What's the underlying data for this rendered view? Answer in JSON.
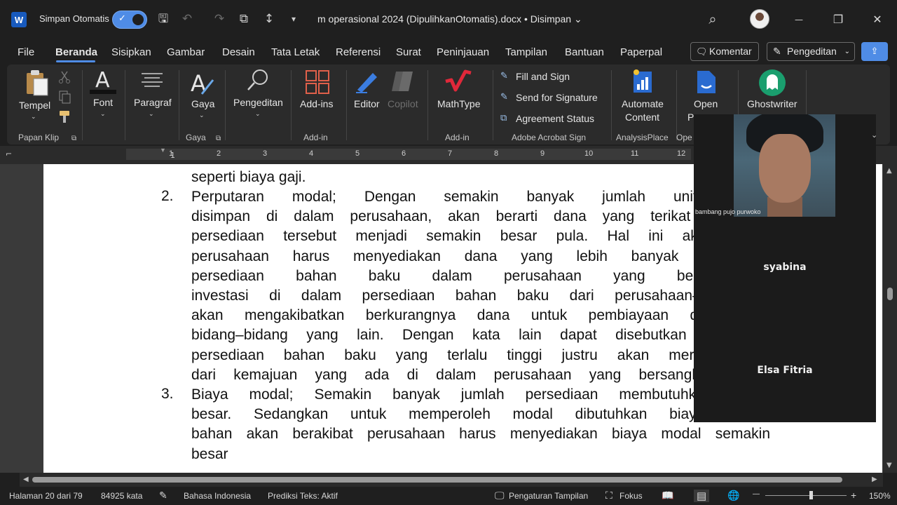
{
  "titlebar": {
    "app_logo": "W",
    "autosave_label": "Simpan Otomatis",
    "autosave_on": true,
    "doc_title": "m operasional 2024 (DipulihkanOtomatis).docx",
    "save_state": "Disimpan",
    "separator": "•",
    "chev": "⌄",
    "icons": {
      "save": "🖫",
      "undo": "↶",
      "redo": "↷",
      "copy": "⧉",
      "spacing": "↕",
      "customize": "▾",
      "search": "⌕",
      "minimize": "—",
      "restore": "❐",
      "close": "✕",
      "check": "✓"
    }
  },
  "menu": {
    "tabs": [
      "File",
      "Beranda",
      "Sisipkan",
      "Gambar",
      "Desain",
      "Tata Letak",
      "Referensi",
      "Surat",
      "Peninjauan",
      "Tampilan",
      "Bantuan",
      "Paperpal"
    ],
    "active": "Beranda",
    "komentar": "Komentar",
    "pengeditan": "Pengeditan",
    "icons": {
      "comment": "🗨",
      "pen": "✎",
      "chev": "⌄",
      "share": "⇪"
    }
  },
  "ribbon": {
    "tempel": "Tempel",
    "font": "Font",
    "paragraf": "Paragraf",
    "gaya": "Gaya",
    "pengeditan": "Pengeditan",
    "addins": "Add-ins",
    "editor": "Editor",
    "copilot": "Copilot",
    "mathtype": "MathType",
    "fill_sign": "Fill and Sign",
    "send_signature": "Send for Signature",
    "agreement_status": "Agreement Status",
    "automate": "Automate",
    "content": "Content",
    "open": "Open",
    "open_p": "P",
    "ghostwriter": "Ghostwriter",
    "chev": "⌄",
    "launcher": "⧉",
    "groups": {
      "papan_klip": "Papan Klip",
      "gaya": "Gaya",
      "addin1": "Add-in",
      "addin2": "Add-in",
      "adobe": "Adobe Acrobat Sign",
      "analysis": "AnalysisPlace",
      "ope": "Ope"
    },
    "collapse": "⌄"
  },
  "ruler": {
    "marks": [
      "1",
      "1",
      "2",
      "3",
      "4",
      "5",
      "6",
      "7",
      "8",
      "9",
      "10",
      "11",
      "12"
    ],
    "tab_marker": "⌐"
  },
  "document": {
    "lines_top": [
      "seperti biaya gaji."
    ],
    "item2": {
      "number": "2.",
      "lines": [
        "Perputaran modal; Dengan semakin banyak  jumlah unit persed",
        "disimpan di dalam perusahaan, akan berarti dana yang terikat di dalan",
        "persediaan tersebut menjadi semakin besar pula. Hal ini akan meng",
        "perusahaan harus menyediakan dana yang lebih banyak untuk p",
        "persediaan bahan baku dalam perusahaan yang bersangkutan.",
        "investasi di dalam persediaan bahan baku dari perusahaan–perusahaa",
        "akan mengakibatkan berkurangnya dana untuk pembiayaan dan inves",
        "bidang–bidang yang lain. Dengan kata lain dapat disebutkan bahwa j",
        "persediaan bahan baku yang terlalu tinggi justru akan merupakan p",
        "dari kemajuan yang ada di dalam perusahaan yang bersangkutan ters"
      ]
    },
    "item3": {
      "number": "3.",
      "lines": [
        "Biaya modal; Semakin banyak jumlah persediaan membutuhkan moda",
        "besar. Sedangkan untuk memperoleh modal dibutuhkan biaya semak",
        "bahan akan berakibat perusahaan harus menyediakan biaya modal semakin",
        "besar"
      ]
    }
  },
  "call": {
    "video_participant": "bambang pujo purwoko",
    "participants": [
      "syabina",
      "Elsa Fitria"
    ],
    "collapse": "⌄"
  },
  "statusbar": {
    "page": "Halaman 20 dari 79",
    "words": "84925 kata",
    "language": "Bahasa Indonesia",
    "prediction": "Prediksi Teks: Aktif",
    "display_settings": "Pengaturan Tampilan",
    "focus": "Fokus",
    "zoom": "150%",
    "icons": {
      "proof": "✎",
      "display": "🖵",
      "focus": "⛶",
      "read": "📖",
      "print": "▤",
      "web": "🌐",
      "minus": "—",
      "plus": "+"
    }
  },
  "colors": {
    "accent": "#4f8ce6",
    "word_blue": "#185abd",
    "page": "#ffffff",
    "chrome": "#1f1f1f"
  }
}
